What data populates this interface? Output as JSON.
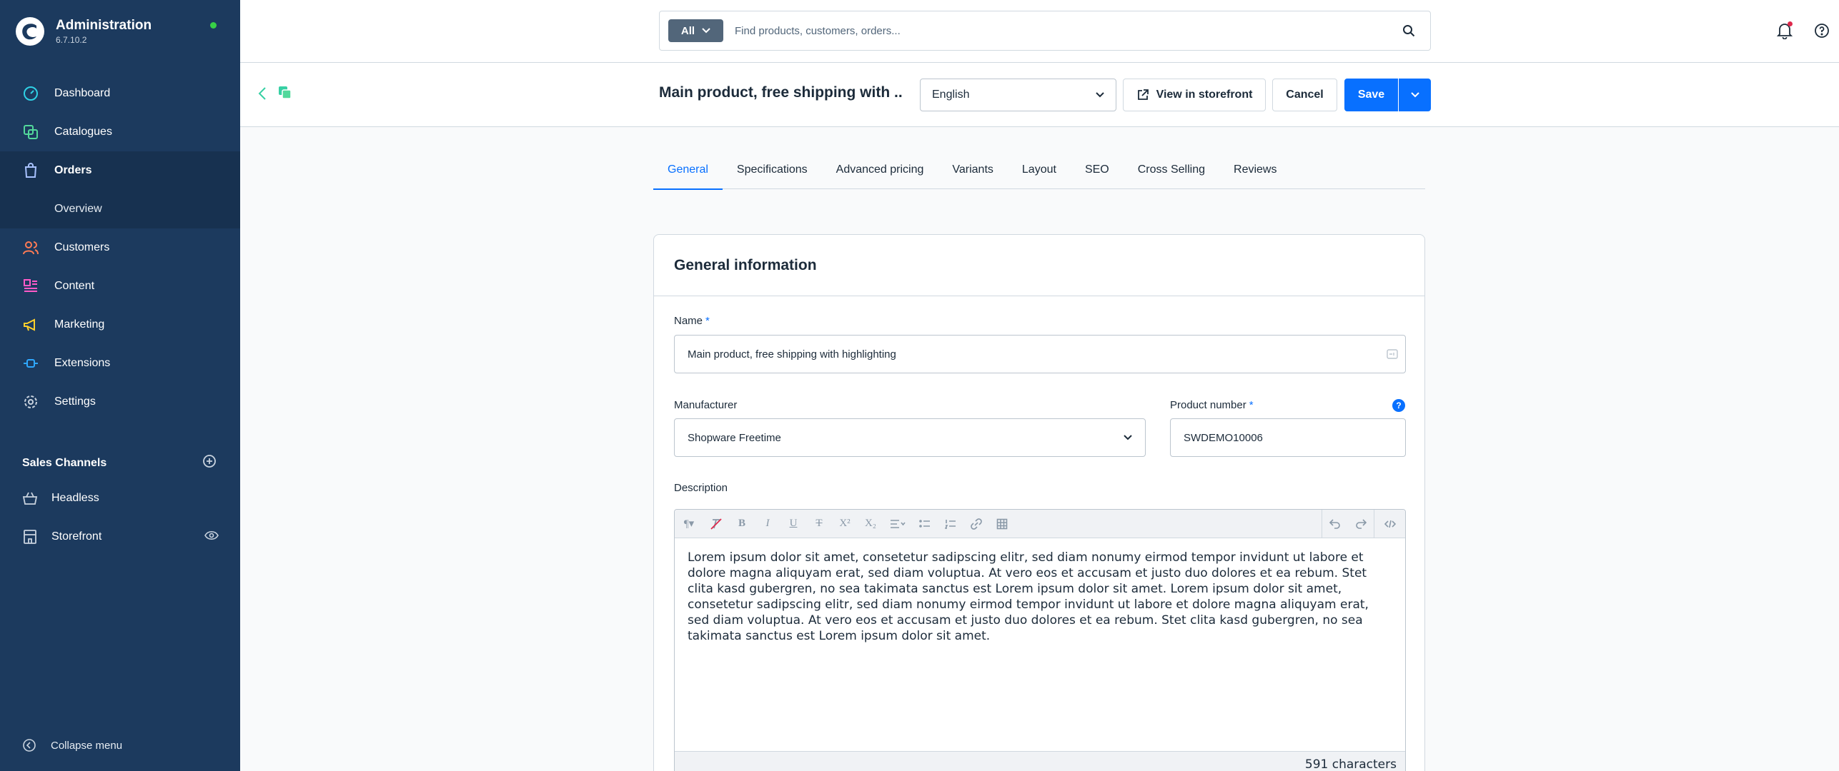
{
  "brand": {
    "title": "Administration",
    "version": "6.7.10.2"
  },
  "sidebar": {
    "items": [
      {
        "label": "Dashboard",
        "icon": "gauge-icon"
      },
      {
        "label": "Catalogues",
        "icon": "catalogue-icon"
      },
      {
        "label": "Orders",
        "icon": "shopping-bag-icon",
        "active": true
      },
      {
        "label": "Overview",
        "sub": true
      },
      {
        "label": "Customers",
        "icon": "users-icon"
      },
      {
        "label": "Content",
        "icon": "content-icon"
      },
      {
        "label": "Marketing",
        "icon": "megaphone-icon"
      },
      {
        "label": "Extensions",
        "icon": "plug-icon"
      },
      {
        "label": "Settings",
        "icon": "gear-icon"
      }
    ],
    "sales_channels_title": "Sales Channels",
    "sales_channels": [
      {
        "label": "Headless",
        "icon": "basket-icon"
      },
      {
        "label": "Storefront",
        "icon": "storefront-icon"
      }
    ],
    "collapse_label": "Collapse menu"
  },
  "search": {
    "type_label": "All",
    "placeholder": "Find products, customers, orders..."
  },
  "smartbar": {
    "title": "Main product, free shipping with ...",
    "language": "English",
    "view_storefront": "View in storefront",
    "cancel": "Cancel",
    "save": "Save"
  },
  "tabs": [
    "General",
    "Specifications",
    "Advanced pricing",
    "Variants",
    "Layout",
    "SEO",
    "Cross Selling",
    "Reviews"
  ],
  "card": {
    "title": "General information",
    "name_label": "Name",
    "name_value": "Main product, free shipping with highlighting",
    "manufacturer_label": "Manufacturer",
    "manufacturer_value": "Shopware Freetime",
    "product_number_label": "Product number",
    "product_number_value": "SWDEMO10006",
    "required_marker": "*",
    "help_glyph": "?",
    "description_label": "Description",
    "description_text": "Lorem ipsum dolor sit amet, consetetur sadipscing elitr, sed diam nonumy eirmod tempor invidunt ut labore et dolore magna aliquyam erat, sed diam voluptua. At vero eos et accusam et justo duo dolores et ea rebum. Stet clita kasd gubergren, no sea takimata sanctus est Lorem ipsum dolor sit amet. Lorem ipsum dolor sit amet, consetetur sadipscing elitr, sed diam nonumy eirmod tempor invidunt ut labore et dolore magna aliquyam erat, sed diam voluptua. At vero eos et accusam et justo duo dolores et ea rebum. Stet clita kasd gubergren, no sea takimata sanctus est Lorem ipsum dolor sit amet.",
    "char_count": "591 characters"
  },
  "colors": {
    "sidebar_bg": "#1c3a5e",
    "primary": "#0870ff",
    "online": "#37d046"
  }
}
